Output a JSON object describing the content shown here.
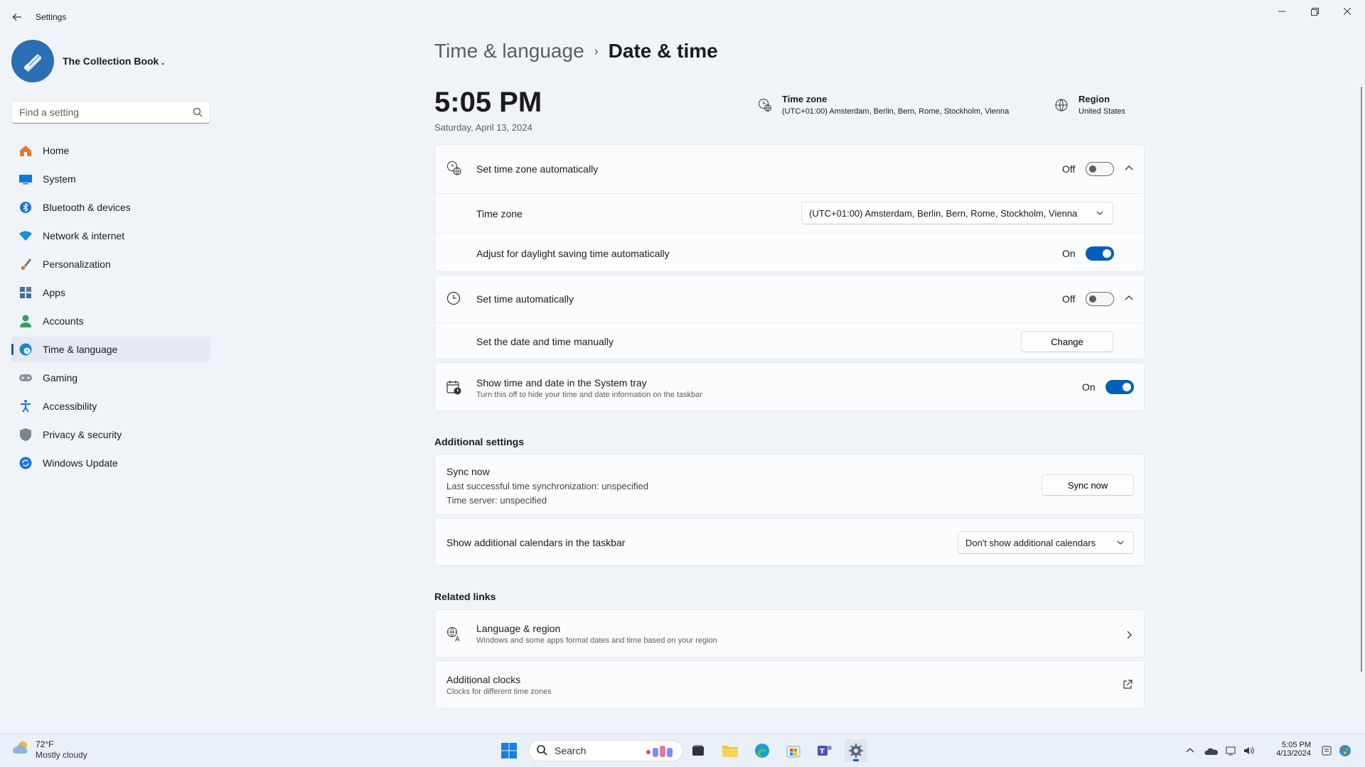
{
  "window": {
    "title": "Settings"
  },
  "profile": {
    "name": "The Collection Book ."
  },
  "search": {
    "placeholder": "Find a setting"
  },
  "nav": [
    {
      "label": "Home",
      "icon": "home-icon",
      "color": "#d9732c"
    },
    {
      "label": "System",
      "icon": "system-icon",
      "color": "#0a7ad6"
    },
    {
      "label": "Bluetooth & devices",
      "icon": "bluetooth-icon",
      "color": "#1a73d9"
    },
    {
      "label": "Network & internet",
      "icon": "wifi-icon",
      "color": "#1a8fe0"
    },
    {
      "label": "Personalization",
      "icon": "brush-icon",
      "color": "#d46a2a"
    },
    {
      "label": "Apps",
      "icon": "apps-icon",
      "color": "#3c6ea8"
    },
    {
      "label": "Accounts",
      "icon": "accounts-icon",
      "color": "#2ea05a"
    },
    {
      "label": "Time & language",
      "icon": "time-language-icon",
      "color": "#1a86d0"
    },
    {
      "label": "Gaming",
      "icon": "gaming-icon",
      "color": "#6b7480"
    },
    {
      "label": "Accessibility",
      "icon": "accessibility-icon",
      "color": "#1a73d9"
    },
    {
      "label": "Privacy & security",
      "icon": "shield-icon",
      "color": "#6b7480"
    },
    {
      "label": "Windows Update",
      "icon": "update-icon",
      "color": "#1a73d9"
    }
  ],
  "breadcrumb": {
    "parent": "Time & language",
    "separator": "›",
    "current": "Date & time"
  },
  "header": {
    "time": "5:05 PM",
    "date": "Saturday, April 13, 2024",
    "timezone_label": "Time zone",
    "timezone_value": "(UTC+01:00) Amsterdam, Berlin, Bern, Rome, Stockholm, Vienna",
    "region_label": "Region",
    "region_value": "United States"
  },
  "settings": {
    "set_tz_auto": {
      "label": "Set time zone automatically",
      "state": "Off"
    },
    "time_zone": {
      "label": "Time zone",
      "value": "(UTC+01:00) Amsterdam, Berlin, Bern, Rome, Stockholm, Vienna"
    },
    "daylight": {
      "label": "Adjust for daylight saving time automatically",
      "state": "On"
    },
    "set_time_auto": {
      "label": "Set time automatically",
      "state": "Off"
    },
    "manual": {
      "label": "Set the date and time manually",
      "button": "Change"
    },
    "systray": {
      "label": "Show time and date in the System tray",
      "sub": "Turn this off to hide your time and date information on the taskbar",
      "state": "On"
    }
  },
  "additional": {
    "title": "Additional settings",
    "sync": {
      "label": "Sync now",
      "line1": "Last successful time synchronization: unspecified",
      "line2": "Time server: unspecified",
      "button": "Sync now"
    },
    "calendars": {
      "label": "Show additional calendars in the taskbar",
      "value": "Don't show additional calendars"
    }
  },
  "related": {
    "title": "Related links",
    "lang_region": {
      "label": "Language & region",
      "sub": "Windows and some apps format dates and time based on your region"
    },
    "clocks": {
      "label": "Additional clocks",
      "sub": "Clocks for different time zones"
    }
  },
  "taskbar": {
    "weather_temp": "72°F",
    "weather_desc": "Mostly cloudy",
    "search": "Search",
    "tray_time": "5:05 PM",
    "tray_date": "4/13/2024"
  },
  "colors": {
    "accent": "#005fb8",
    "background": "#f0f4f9",
    "card": "#fbfcfd"
  }
}
